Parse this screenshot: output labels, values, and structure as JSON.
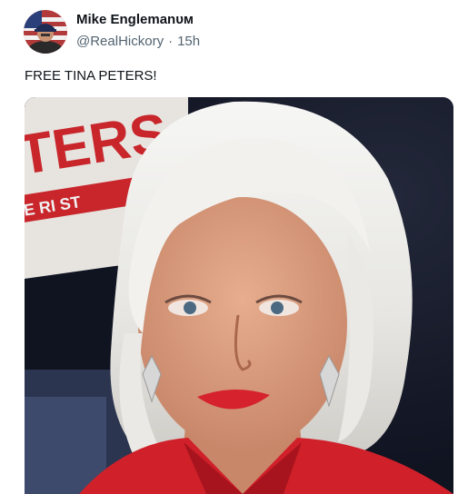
{
  "post": {
    "author_name": "Mike Englemanᴜᴍ",
    "handle": "@RealHickory",
    "separator": "·",
    "time": "15h",
    "text": "FREE TINA PETERS!",
    "background_sign_text": "TERS",
    "background_sign_subtext": "E RI ST"
  },
  "icons": {
    "avatar": "avatar-photo",
    "media": "photo"
  },
  "colors": {
    "name": "#0f1419",
    "secondary": "#536471",
    "sign_red": "#c8262b",
    "jacket_red": "#d0202a"
  }
}
